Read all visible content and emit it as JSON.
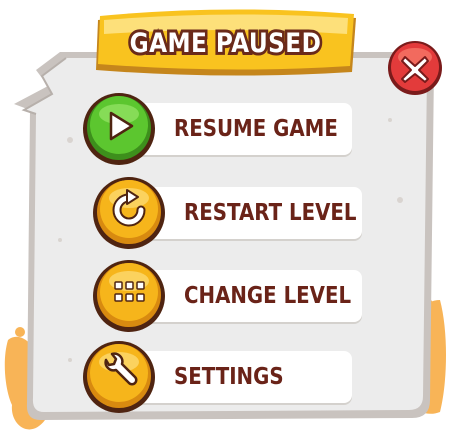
{
  "title": "GAME PAUSED",
  "close": {
    "icon": "close-x-icon",
    "color": "#e33b3b"
  },
  "menu": [
    {
      "id": "resume",
      "label": "RESUME GAME",
      "icon": "play-icon",
      "color": "#56c12c"
    },
    {
      "id": "restart",
      "label": "RESTART LEVEL",
      "icon": "restart-icon",
      "color": "#f2b51a"
    },
    {
      "id": "change",
      "label": "CHANGE LEVEL",
      "icon": "grid-icon",
      "color": "#f2b51a"
    },
    {
      "id": "settings",
      "label": "SETTINGS",
      "icon": "wrench-icon",
      "color": "#f2b51a"
    }
  ],
  "colors": {
    "panel": "#ececec",
    "frame": "#c7c1bd",
    "banner": "#f9c31f",
    "splash": "#f7b55a",
    "label": "#6a2318"
  }
}
